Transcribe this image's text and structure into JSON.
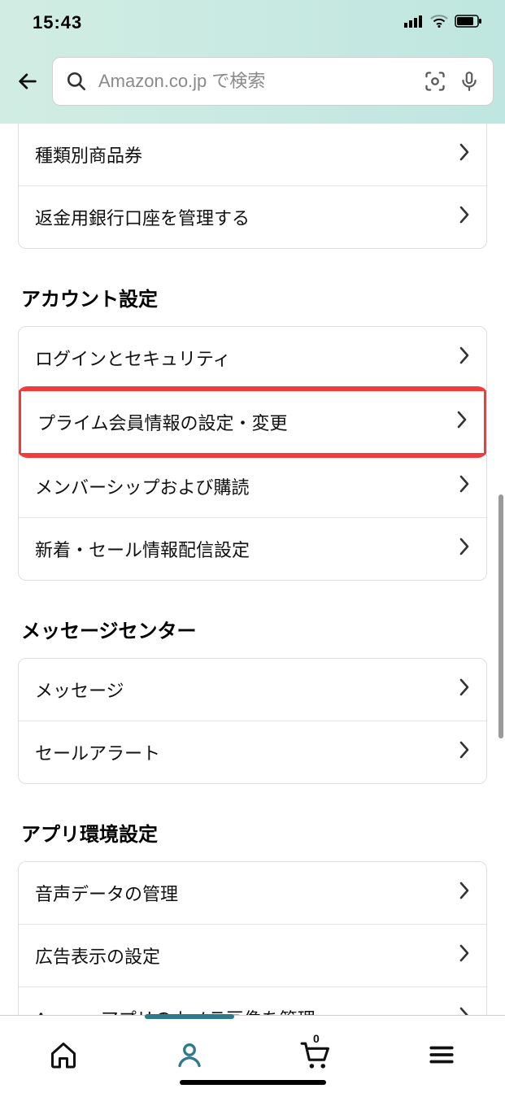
{
  "status": {
    "time": "15:43"
  },
  "search": {
    "placeholder": "Amazon.co.jp で検索"
  },
  "top_group": {
    "items": [
      {
        "label": "種類別商品券"
      },
      {
        "label": "返金用銀行口座を管理する"
      }
    ]
  },
  "sections": [
    {
      "title": "アカウント設定",
      "items": [
        {
          "label": "ログインとセキュリティ",
          "highlight": false
        },
        {
          "label": "プライム会員情報の設定・変更",
          "highlight": true
        },
        {
          "label": "メンバーシップおよび購読",
          "highlight": false
        },
        {
          "label": "新着・セール情報配信設定",
          "highlight": false
        }
      ]
    },
    {
      "title": "メッセージセンター",
      "items": [
        {
          "label": "メッセージ"
        },
        {
          "label": "セールアラート"
        }
      ]
    },
    {
      "title": "アプリ環境設定",
      "items": [
        {
          "label": "音声データの管理"
        },
        {
          "label": "広告表示の設定"
        },
        {
          "label": "Amazonアプリのカメラ画像を管理"
        }
      ]
    }
  ],
  "tabbar": {
    "items": [
      "home",
      "account",
      "cart",
      "menu"
    ],
    "active": "account",
    "cart_badge": "0"
  }
}
